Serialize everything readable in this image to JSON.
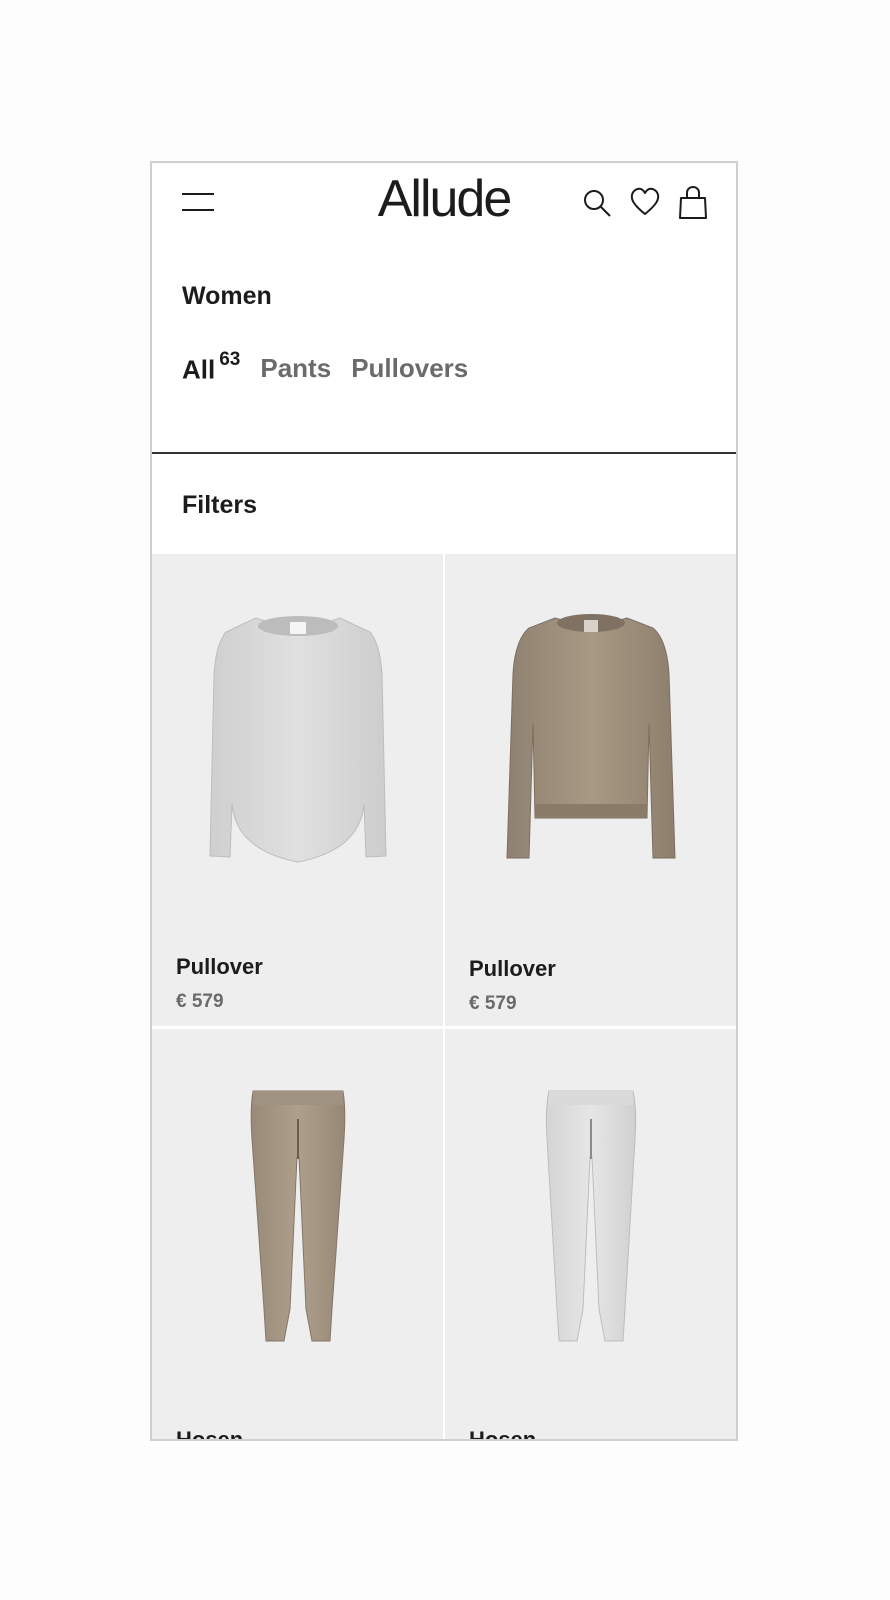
{
  "header": {
    "logo": "Allude",
    "menu_icon": "hamburger-menu-icon",
    "icons": [
      "search-icon",
      "heart-icon",
      "shopping-bag-icon"
    ]
  },
  "category": {
    "title": "Women"
  },
  "tabs": [
    {
      "label": "All",
      "count": "63",
      "active": true
    },
    {
      "label": "Pants",
      "active": false
    },
    {
      "label": "Pullovers",
      "active": false
    }
  ],
  "filters": {
    "label": "Filters"
  },
  "products": [
    {
      "name": "Pullover",
      "price": "€ 579",
      "color": "#dcdcdc",
      "type": "sweater-light"
    },
    {
      "name": "Pullover",
      "price": "€ 579",
      "color": "#a59683",
      "type": "sweater-beige"
    },
    {
      "name": "Hosen",
      "price": "",
      "color": "#a89b88",
      "type": "pants-beige"
    },
    {
      "name": "Hosen",
      "price": "",
      "color": "#dedede",
      "type": "pants-light"
    }
  ],
  "colors": {
    "card_background": "#eeeeee",
    "text_primary": "#1c1c1c",
    "text_secondary": "#6b6b6b"
  }
}
